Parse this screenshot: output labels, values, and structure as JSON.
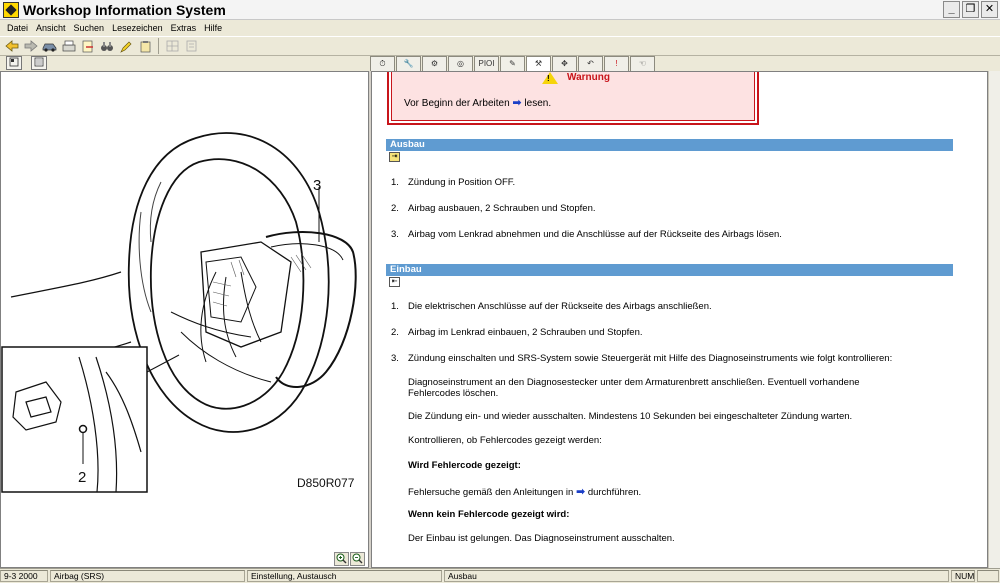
{
  "window": {
    "title": "Workshop Information System",
    "controls": [
      "_",
      "❐",
      "✕"
    ]
  },
  "menu": [
    "Datei",
    "Ansicht",
    "Suchen",
    "Lesezeichen",
    "Extras",
    "Hilfe"
  ],
  "figure": {
    "callout_3": "3",
    "callout_2": "2",
    "reference": "D850R077"
  },
  "warning": {
    "title": "Warnung",
    "text_before": "Vor Beginn der Arbeiten",
    "text_after": "lesen."
  },
  "ausbau": {
    "heading": "Ausbau",
    "steps": [
      {
        "num": "1.",
        "text": "Zündung in Position OFF."
      },
      {
        "num": "2.",
        "text": "Airbag ausbauen, 2 Schrauben und Stopfen."
      },
      {
        "num": "3.",
        "text": "Airbag vom Lenkrad abnehmen und die Anschlüsse auf der Rückseite des Airbags lösen."
      }
    ]
  },
  "einbau": {
    "heading": "Einbau",
    "steps": [
      {
        "num": "1.",
        "text": "Die elektrischen Anschlüsse auf der Rückseite des Airbags anschließen."
      },
      {
        "num": "2.",
        "text": "Airbag im Lenkrad einbauen, 2 Schrauben und Stopfen."
      },
      {
        "num": "3.",
        "text": "Zündung einschalten und SRS-System sowie Steuergerät mit Hilfe des Diagnoseinstruments wie folgt kontrollieren:"
      }
    ],
    "details": {
      "line1": "Diagnoseinstrument an den Diagnosestecker unter dem Armaturenbrett anschließen. Eventuell vorhandene",
      "line2": "Fehlercodes löschen.",
      "line3": "Die Zündung ein- und wieder ausschalten. Mindestens 10 Sekunden bei eingeschalteter Zündung warten.",
      "line4": "Kontrollieren, ob Fehlercodes gezeigt werden:",
      "heading_yes": "Wird Fehlercode gezeigt:",
      "yes_before": "Fehlersuche gemäß den Anleitungen in",
      "yes_after": "durchführen.",
      "heading_no": "Wenn kein Fehlercode gezeigt wird:",
      "no_text": "Der Einbau ist gelungen. Das Diagnoseinstrument ausschalten."
    }
  },
  "tabs": [
    "⏱",
    "🔧",
    "⚙",
    "◎",
    "PIOI",
    "✎",
    "⚒",
    "✥",
    "↶",
    "!",
    "☜"
  ],
  "status": {
    "model": "9-3 2000",
    "system": "Airbag (SRS)",
    "operation": "Einstellung, Austausch",
    "section": "Ausbau",
    "numlock": "NUM"
  },
  "colors": {
    "section_bar": "#5f9bd1",
    "warning_border": "#c8151b",
    "warning_fill": "#fde2e2",
    "link_arrow": "#1b3fc7"
  }
}
